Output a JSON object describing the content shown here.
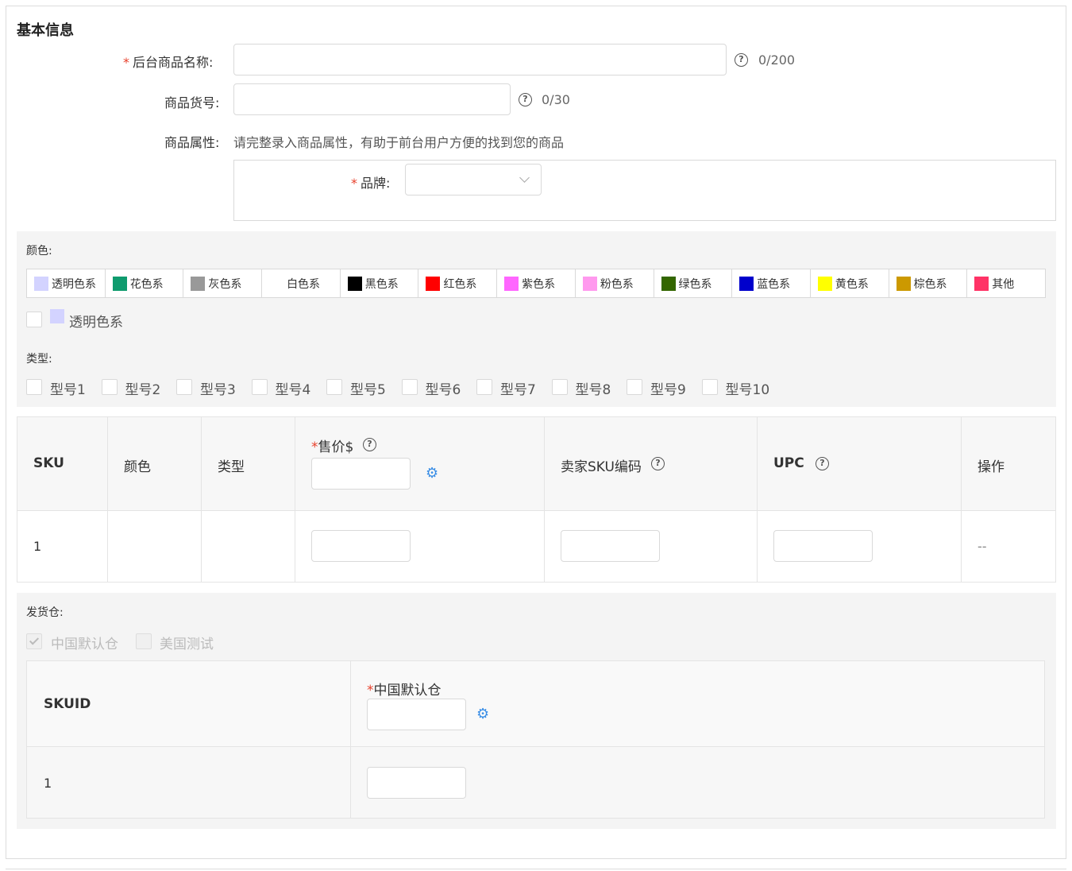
{
  "section": {
    "title": "基本信息"
  },
  "form": {
    "name_label": "后台商品名称:",
    "name_counter": "0/200",
    "sku_no_label": "商品货号:",
    "sku_no_counter": "0/30",
    "attr_label": "商品属性:",
    "attr_hint": "请完整录入商品属性，有助于前台用户方便的找到您的商品",
    "brand_label": "品牌:",
    "brand_value": "",
    "required_mark": "*"
  },
  "variants": {
    "color_label": "颜色:",
    "color_tabs": [
      {
        "label": "透明色系",
        "color": "#d3d3ff"
      },
      {
        "label": "花色系",
        "color": "#0f9b6e"
      },
      {
        "label": "灰色系",
        "color": "#999999"
      },
      {
        "label": "白色系",
        "color": "#ffffff"
      },
      {
        "label": "黑色系",
        "color": "#000000"
      },
      {
        "label": "红色系",
        "color": "#ff0000"
      },
      {
        "label": "紫色系",
        "color": "#ff66ff"
      },
      {
        "label": "粉色系",
        "color": "#ff99ee"
      },
      {
        "label": "绿色系",
        "color": "#336600"
      },
      {
        "label": "蓝色系",
        "color": "#0000cc"
      },
      {
        "label": "黄色系",
        "color": "#ffff00"
      },
      {
        "label": "棕色系",
        "color": "#cc9900"
      },
      {
        "label": "其他",
        "color": "#ff3366"
      }
    ],
    "color_option": {
      "label": "透明色系",
      "color": "#d3d3ff",
      "checked": false
    },
    "type_label": "类型:",
    "types": [
      "型号1",
      "型号2",
      "型号3",
      "型号4",
      "型号5",
      "型号6",
      "型号7",
      "型号8",
      "型号9",
      "型号10"
    ]
  },
  "sku_table": {
    "headers": {
      "sku": "SKU",
      "color": "颜色",
      "type": "类型",
      "price": "售价$",
      "seller_sku": "卖家SKU编码",
      "upc": "UPC",
      "action": "操作"
    },
    "rows": [
      {
        "sku": "1",
        "color": "",
        "type": "",
        "action": "--"
      }
    ]
  },
  "warehouse": {
    "label": "发货仓:",
    "options": [
      {
        "label": "中国默认仓",
        "checked": true,
        "disabled": true
      },
      {
        "label": "美国测试",
        "checked": false,
        "disabled": true
      }
    ],
    "table": {
      "headers": {
        "skuid": "SKUID",
        "wh": "中国默认仓"
      },
      "rows": [
        {
          "skuid": "1"
        }
      ]
    }
  },
  "icons": {
    "help": "?",
    "gear": "⚙"
  }
}
